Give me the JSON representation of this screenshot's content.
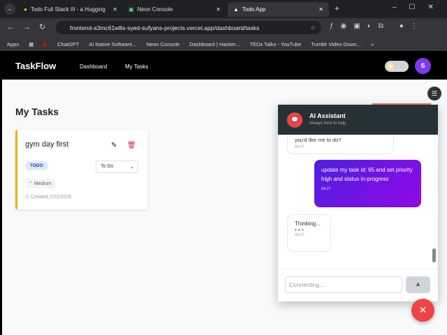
{
  "browser": {
    "tabs": [
      {
        "title": "Todo Full Stack III - a Hugging",
        "icon": "hugging-face-icon"
      },
      {
        "title": "Neon Console",
        "icon": "neon-icon"
      },
      {
        "title": "Todo App",
        "icon": "vercel-icon",
        "active": true
      }
    ],
    "url": "frontend-a3mc61w8s-syed-sufyans-projects.vercel.app/dashboard/tasks",
    "bookmarks": [
      "Apps",
      "ChatGPT",
      "AI Native Software...",
      "Neon Console",
      "Dashboard | Hacker...",
      "TEDx Talks - YouTube",
      "Tumblr Video Down..."
    ]
  },
  "app": {
    "brand": "TaskFlow",
    "nav": [
      "Dashboard",
      "My Tasks"
    ],
    "avatar": "S"
  },
  "main": {
    "title": "My Tasks",
    "task": {
      "title": "gym day first",
      "status_badge": "TODO",
      "status_select": "To Do",
      "priority": "Medium",
      "created": "Created 2/22/2026"
    }
  },
  "chat": {
    "title": "AI Assistant",
    "subtitle": "Always here to help",
    "messages": [
      {
        "from": "assistant",
        "text": "you'd like me to do?",
        "time": "04:27"
      },
      {
        "from": "user",
        "text": "update my task id: 65 and set priority high and status in-progress",
        "time": "04:27"
      },
      {
        "from": "assistant",
        "text": "Thinking...",
        "time": "04:27"
      }
    ],
    "input_placeholder": "Connecting..."
  },
  "colors": {
    "accent": "#7c3aed",
    "danger": "#ef4444",
    "chat_header": "#263238"
  }
}
